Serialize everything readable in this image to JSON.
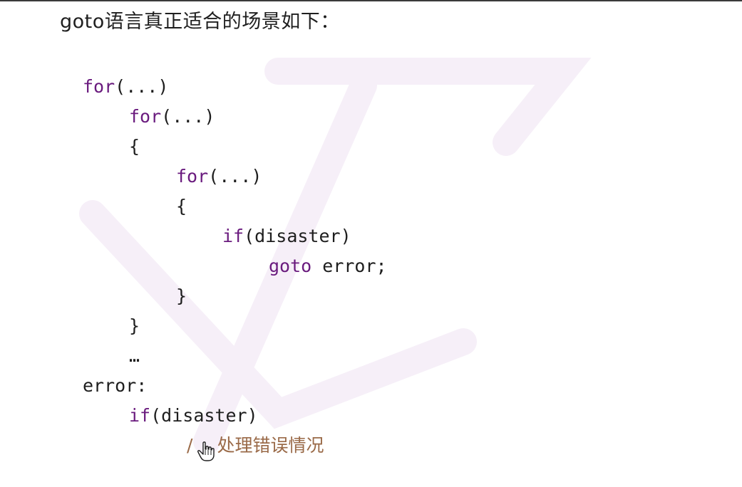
{
  "heading": "goto语言真正适合的场景如下：",
  "code": {
    "l1_kw": "for",
    "l1_rest": "(...)",
    "l2_kw": "for",
    "l2_rest": "(...)",
    "l3": "{",
    "l4_kw": "for",
    "l4_rest": "(...)",
    "l5": "{",
    "l6_kw": "if",
    "l6_rest": "(disaster)",
    "l7_kw": "goto",
    "l7_rest": " error;",
    "l8": "}",
    "l9": "}",
    "l10": "…",
    "l11": "error:",
    "l12_kw": "if",
    "l12_rest": "(disaster)",
    "l13_slash": "/",
    "l13_comment": "处理错误情况"
  },
  "colors": {
    "keyword": "#6a1b7e",
    "text": "#1e1e1e",
    "comment": "#9a6a48"
  },
  "icons": {
    "cursor": "hand-pointer-icon"
  }
}
